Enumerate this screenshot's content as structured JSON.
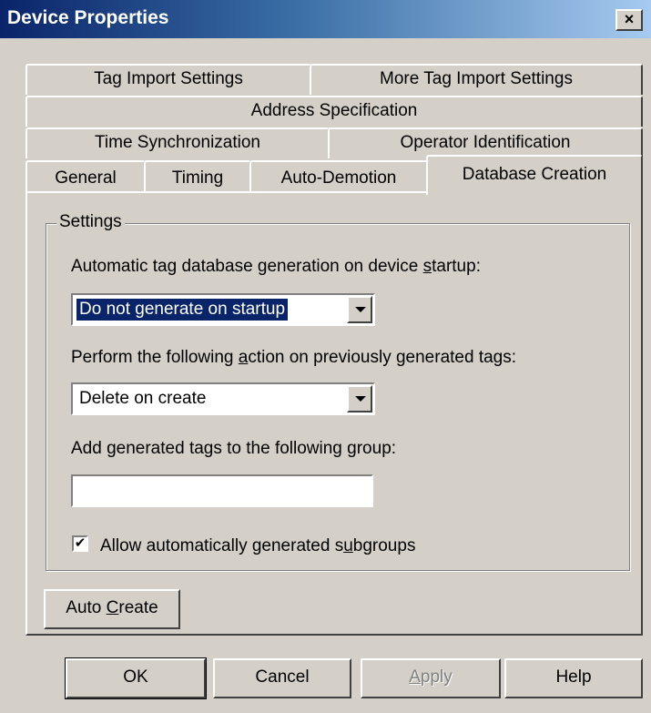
{
  "window": {
    "title": "Device Properties",
    "close_label": "×"
  },
  "tabs": {
    "row1": [
      "Tag Import Settings",
      "More Tag Import Settings"
    ],
    "row2": [
      "Address Specification"
    ],
    "row3": [
      "Time Synchronization",
      "Operator Identification"
    ],
    "row4": [
      "General",
      "Timing",
      "Auto-Demotion",
      "Database Creation"
    ],
    "active": "Database Creation"
  },
  "settings": {
    "group_label": "Settings",
    "startup_label_pre": "Automatic tag database generation on device ",
    "startup_label_key": "s",
    "startup_label_post": "tartup:",
    "startup_value": "Do not generate on startup",
    "action_label_pre": "Perform the following ",
    "action_label_key": "a",
    "action_label_post": "ction on previously generated tags:",
    "action_value": "Delete on create",
    "group_field_pre": "Add generated tags to the following ",
    "group_field_key": "g",
    "group_field_post": "roup:",
    "group_field_value": "",
    "subgroups_pre": "Allow automatically generated s",
    "subgroups_key": "u",
    "subgroups_post": "bgroups",
    "subgroups_checked": true,
    "check_glyph": "✔"
  },
  "auto_create": {
    "pre": "Auto ",
    "key": "C",
    "post": "reate"
  },
  "footer": {
    "ok": "OK",
    "cancel": "Cancel",
    "apply_key": "A",
    "apply_rest": "pply",
    "help": "Help"
  }
}
